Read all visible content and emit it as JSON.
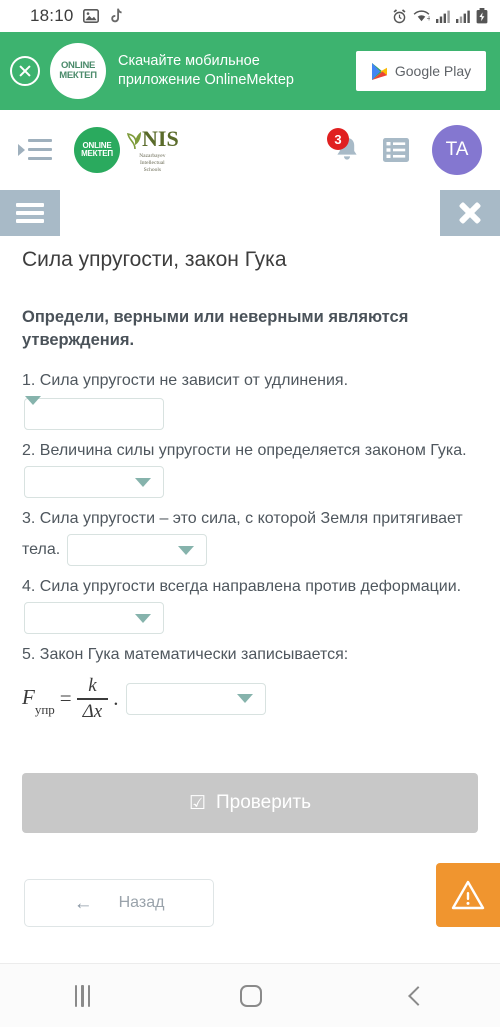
{
  "status_bar": {
    "time": "18:10",
    "left_icons": [
      "image-icon",
      "tiktok-icon"
    ],
    "right_icons": [
      "alarm-icon",
      "wifi-icon",
      "signal-bars-icon",
      "signal-bars-2-icon",
      "battery-charging-icon"
    ]
  },
  "promo_banner": {
    "close_label": "close-icon",
    "logo_line1": "ONLINE",
    "logo_line2": "МЕКТЕП",
    "text_line1": "Скачайте мобильное",
    "text_line2": "приложение OnlineMektep",
    "store_button_label": "Google Play",
    "background_color": "#3db36f"
  },
  "appbar": {
    "menu_icon": "indent-menu-icon",
    "brand_circle_line1": "ONLINE",
    "brand_circle_line2": "МЕКТЕП",
    "nis_title": "NIS",
    "nis_subtitle_line1": "Nazarbayev",
    "nis_subtitle_line2": "Intellectual",
    "nis_subtitle_line3": "Schools",
    "notification_count": "3",
    "list_icon": "list-icon",
    "avatar_initials": "TA",
    "avatar_color": "#8477d0"
  },
  "toolbar": {
    "menu_label": "hamburger-icon",
    "close_label": "close-icon",
    "background_color": "#a8bac7"
  },
  "lesson": {
    "title": "Сила упругости, закон Гука",
    "prompt": "Определи, верными или неверными являются утверждения.",
    "questions": [
      {
        "number": "1.",
        "text": "Сила упругости не зависит от удлинения.",
        "dropdown_value": "",
        "dropdown_below": true
      },
      {
        "number": "2.",
        "text": "Величина силы упругости не определяется законом Гука.",
        "dropdown_value": "",
        "dropdown_below": false
      },
      {
        "number": "3.",
        "text": "Сила упругости – это сила, с которой Земля притягивает тела.",
        "dropdown_value": "",
        "dropdown_below": false
      },
      {
        "number": "4.",
        "text": "Сила упругости всегда направлена против деформации.",
        "dropdown_value": "",
        "dropdown_below": false
      }
    ],
    "question5": {
      "number": "5.",
      "text": "Закон Гука математически записывается:",
      "formula": {
        "variable": "F",
        "subscript": "упр",
        "equals": "=",
        "numerator": "k",
        "denominator": "Δx",
        "trailing": "."
      },
      "dropdown_value": ""
    }
  },
  "actions": {
    "check_icon": "☑",
    "check_label": "Проверить",
    "back_icon": "←",
    "back_label": "Назад",
    "warning_icon": "warning-triangle-icon",
    "warning_color": "#f0952f"
  },
  "nav_bar": {
    "recent_label": "recent-apps-icon",
    "home_label": "home-icon",
    "back_label": "back-icon"
  }
}
